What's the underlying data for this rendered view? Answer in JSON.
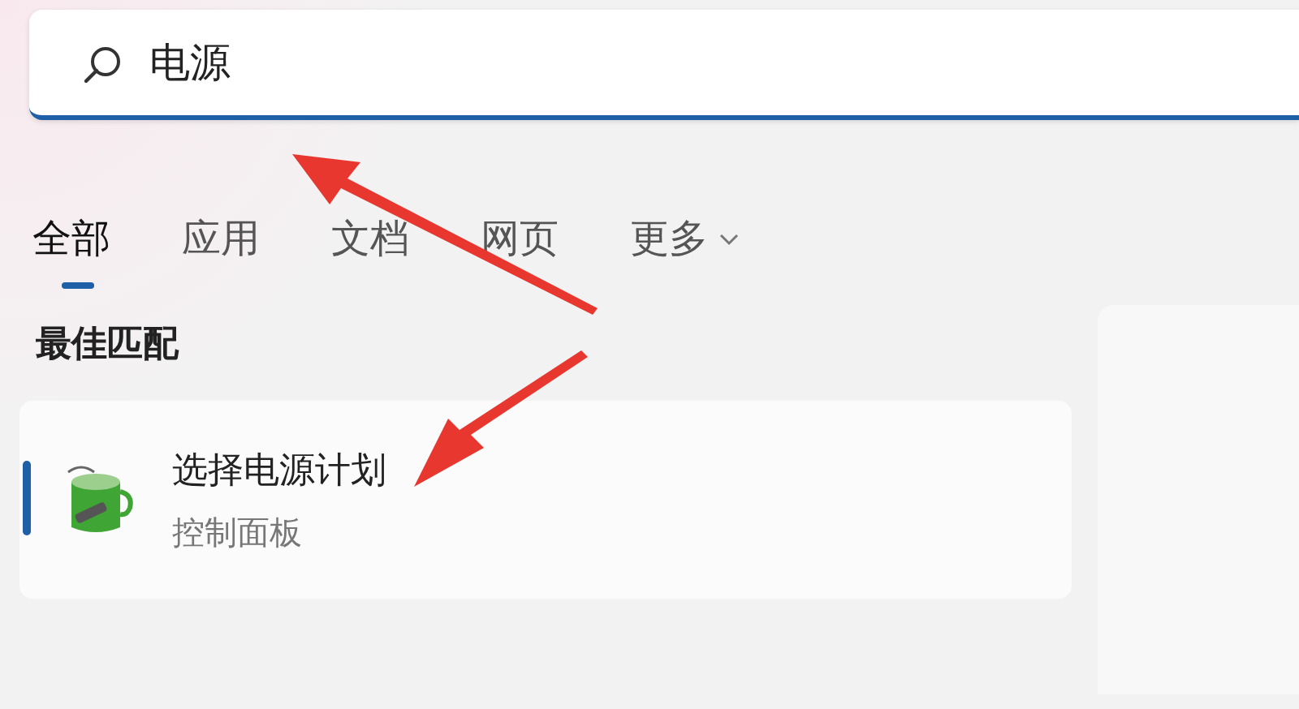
{
  "search": {
    "value": "电源"
  },
  "tabs": [
    {
      "label": "全部",
      "selected": true
    },
    {
      "label": "应用",
      "selected": false
    },
    {
      "label": "文档",
      "selected": false
    },
    {
      "label": "网页",
      "selected": false
    },
    {
      "label": "更多",
      "selected": false,
      "kind": "dropdown"
    }
  ],
  "section_title": "最佳匹配",
  "best_match": {
    "title": "选择电源计划",
    "subtitle": "控制面板",
    "selected": true
  }
}
